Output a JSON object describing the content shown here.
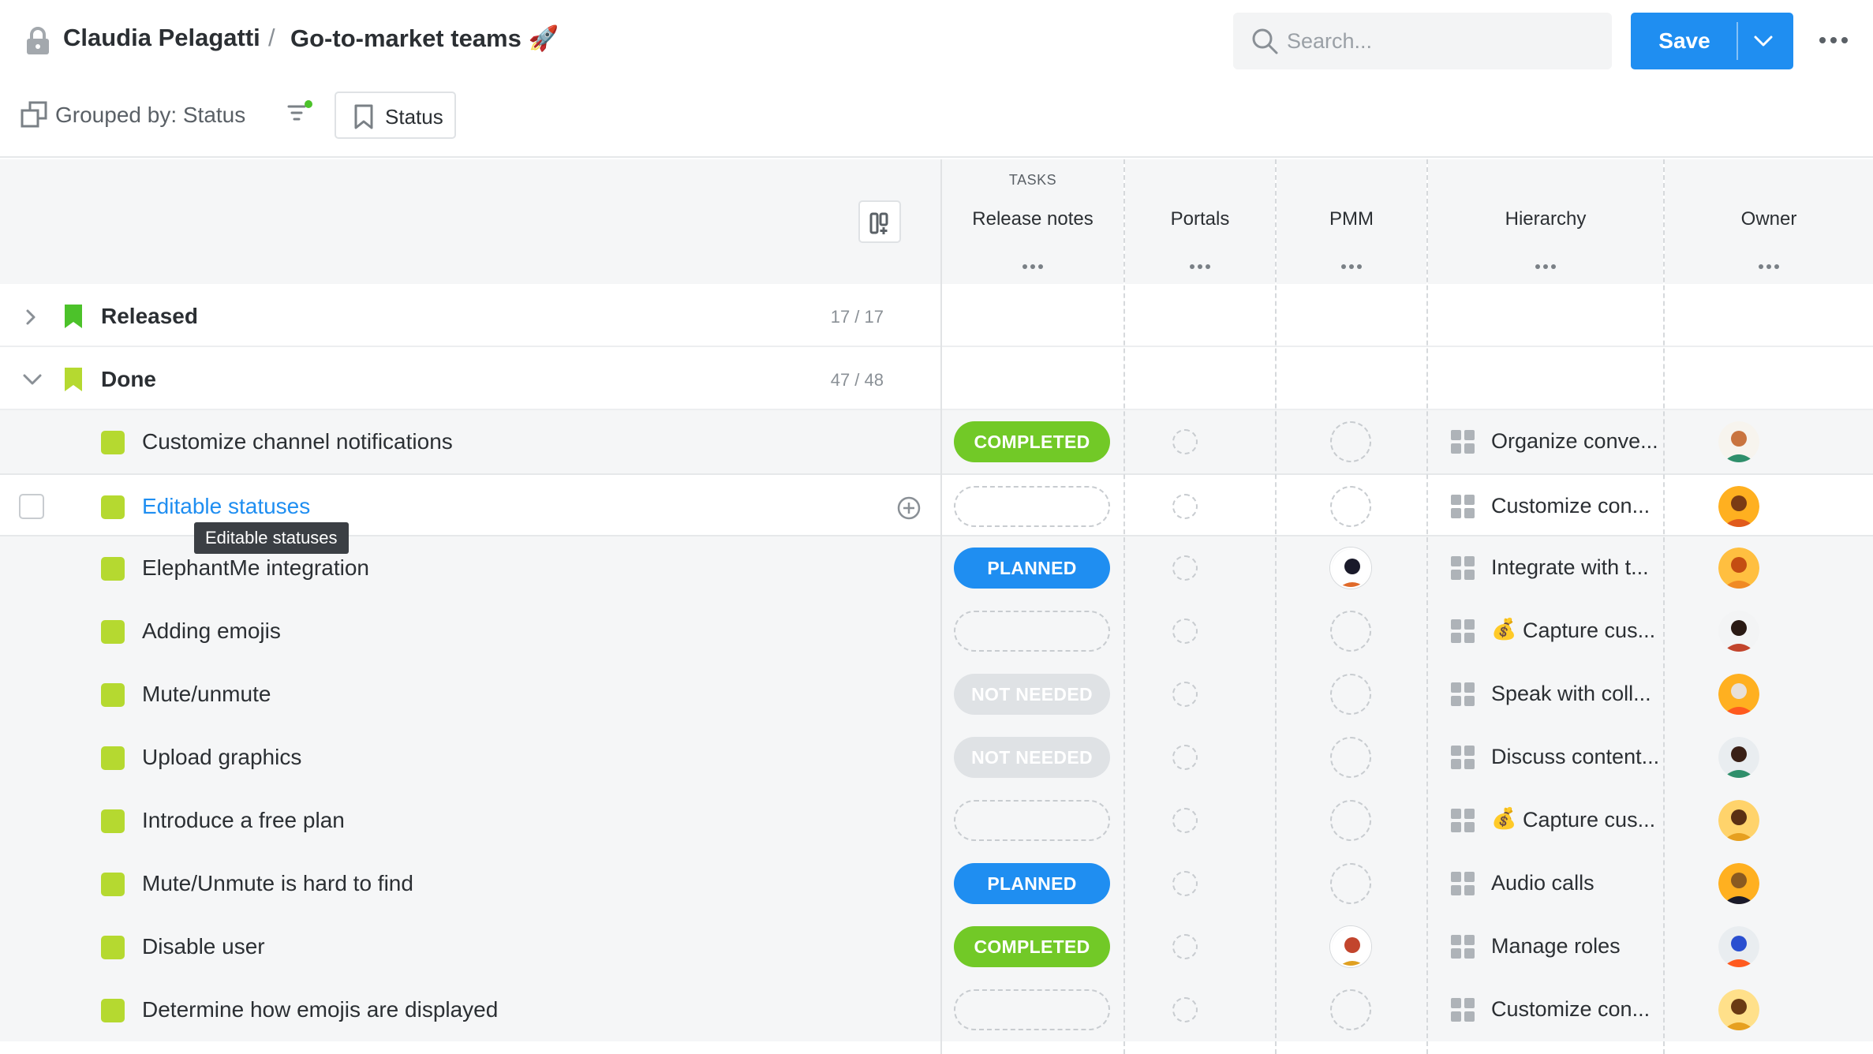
{
  "header": {
    "owner": "Claudia Pelagatti",
    "separator": "/",
    "board_title": "Go-to-market teams 🚀",
    "search_placeholder": "Search...",
    "save_label": "Save",
    "grouped_by": "Grouped by: Status",
    "status_chip": "Status"
  },
  "columns": {
    "group_label": "TASKS",
    "release_notes": "Release notes",
    "portals": "Portals",
    "pmm": "PMM",
    "hierarchy": "Hierarchy",
    "owner": "Owner"
  },
  "groups": [
    {
      "name": "Released",
      "count": "17 / 17",
      "expanded": false
    },
    {
      "name": "Done",
      "count": "47 / 48",
      "expanded": true
    }
  ],
  "rows": [
    {
      "name": "Customize channel notifications",
      "release": "COMPLETED",
      "hierarchy": "Organize conve...",
      "hierarchy_emoji": "",
      "pmm_avatar": false
    },
    {
      "name": "Editable statuses",
      "release": "",
      "hierarchy": "Customize con...",
      "hierarchy_emoji": "",
      "pmm_avatar": false
    },
    {
      "name": "ElephantMe integration",
      "release": "PLANNED",
      "hierarchy": "Integrate with t...",
      "hierarchy_emoji": "",
      "pmm_avatar": true
    },
    {
      "name": "Adding emojis",
      "release": "",
      "hierarchy": "Capture cus...",
      "hierarchy_emoji": "💰",
      "pmm_avatar": false
    },
    {
      "name": "Mute/unmute",
      "release": "NOT NEEDED",
      "hierarchy": "Speak with coll...",
      "hierarchy_emoji": "",
      "pmm_avatar": false
    },
    {
      "name": "Upload graphics",
      "release": "NOT NEEDED",
      "hierarchy": "Discuss content...",
      "hierarchy_emoji": "",
      "pmm_avatar": false
    },
    {
      "name": "Introduce a free plan",
      "release": "",
      "hierarchy": "Capture cus...",
      "hierarchy_emoji": "💰",
      "pmm_avatar": false
    },
    {
      "name": "Mute/Unmute is hard to find",
      "release": "PLANNED",
      "hierarchy": "Audio calls",
      "hierarchy_emoji": "",
      "pmm_avatar": false
    },
    {
      "name": "Disable user",
      "release": "COMPLETED",
      "hierarchy": "Manage roles",
      "hierarchy_emoji": "",
      "pmm_avatar": true
    },
    {
      "name": "Determine how emojis are displayed",
      "release": "",
      "hierarchy": "Customize con...",
      "hierarchy_emoji": "",
      "pmm_avatar": false
    }
  ],
  "tooltip": "Editable statuses",
  "colors": {
    "accent": "#1f8ef1",
    "completed": "#72c927",
    "not_needed": "#dfe2e5",
    "status_square": "#b5d930"
  }
}
